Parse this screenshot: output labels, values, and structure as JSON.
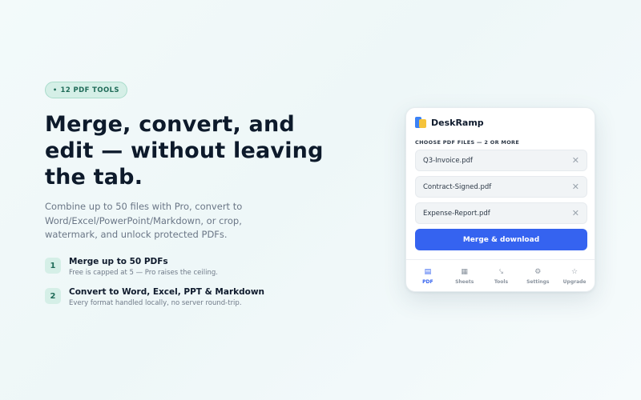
{
  "badge": {
    "dot": "•",
    "label": "12 PDF TOOLS"
  },
  "hero": {
    "title": "Merge, convert, and edit — without leaving the tab.",
    "subtitle": "Combine up to 50 files with Pro, convert to Word/Excel/PowerPoint/Markdown, or crop, watermark, and unlock protected PDFs."
  },
  "features": [
    {
      "num": "1",
      "title": "Merge up to 50 PDFs",
      "desc": "Free is capped at 5 — Pro raises the ceiling."
    },
    {
      "num": "2",
      "title": "Convert to Word, Excel, PPT & Markdown",
      "desc": "Every format handled locally, no server round-trip."
    }
  ],
  "card": {
    "brand": "DeskRamp",
    "choose_label": "CHOOSE PDF FILES — 2 OR MORE",
    "files": [
      "Q3-Invoice.pdf",
      "Contract-Signed.pdf",
      "Expense-Report.pdf"
    ],
    "remove_glyph": "✕",
    "merge_label": "Merge & download",
    "tabs": [
      {
        "icon": "▤",
        "label": "PDF"
      },
      {
        "icon": "▦",
        "label": "Sheets"
      },
      {
        "icon": "⤥",
        "label": "Tools"
      },
      {
        "icon": "⚙",
        "label": "Settings"
      },
      {
        "icon": "☆",
        "label": "Upgrade"
      }
    ]
  },
  "colors": {
    "accent": "#3563f0",
    "badge_bg": "#d5efe7",
    "badge_text": "#1f6b58"
  }
}
